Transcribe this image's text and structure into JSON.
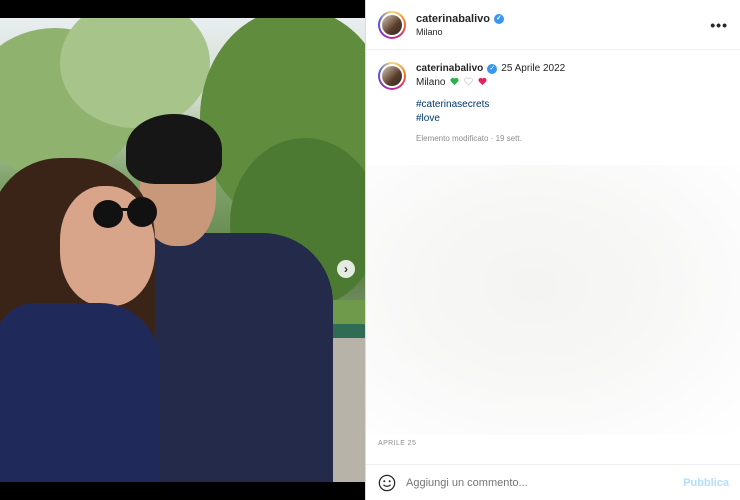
{
  "post": {
    "username": "caterinabalivo",
    "location": "Milano",
    "more_icon": "•••",
    "next_icon": "›"
  },
  "caption": {
    "username": "caterinabalivo",
    "date": "25 Aprile 2022",
    "text": "Milano",
    "hearts": [
      "green",
      "white",
      "red"
    ],
    "hashtags": [
      "#caterinasecrets",
      "#love"
    ],
    "edited": "Elemento modificato · 19 sett."
  },
  "footer": {
    "date_label": "APRILE 25",
    "comment_placeholder": "Aggiungi un commento...",
    "publish_label": "Pubblica"
  },
  "carousel": {
    "dot_count": 6,
    "active_index": 0
  },
  "colors": {
    "verified": "#3897f0",
    "hashtag": "#00376b",
    "publish": "#b2dffc"
  }
}
